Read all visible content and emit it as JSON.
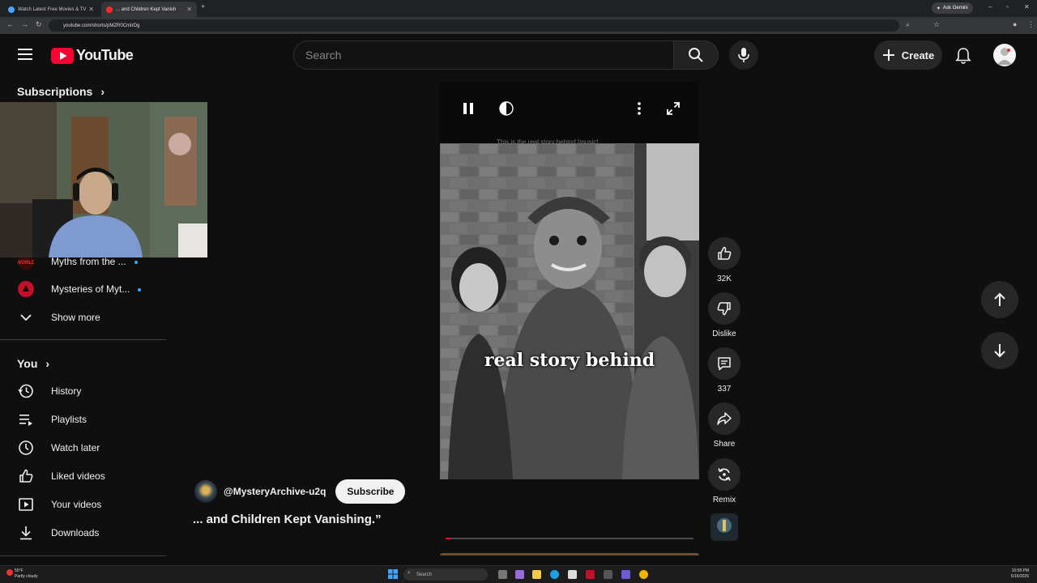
{
  "browser": {
    "tabs": [
      {
        "label": "Watch Latest Free Movies & TV",
        "favicon_color": "#4aa3ff"
      },
      {
        "label": "... and Children Kept Vanish",
        "favicon_color": "#ff2a2a"
      }
    ],
    "url": "youtube.com/shorts/pMZR0CmIrDg",
    "ask_gemini": "Ask Gemini"
  },
  "header": {
    "logo_text": "YouTube",
    "search_placeholder": "Search",
    "create_label": "Create"
  },
  "sidebar": {
    "subscriptions_title": "Subscriptions",
    "subscriptions": [
      {
        "label": "Myths from the ...",
        "icon": "channel-avatar",
        "new": true
      },
      {
        "label": "Mysteries of Myt...",
        "icon": "channel-avatar",
        "new": true
      }
    ],
    "show_more": "Show more",
    "you_title": "You",
    "you_items": [
      {
        "label": "History",
        "icon": "history-icon"
      },
      {
        "label": "Playlists",
        "icon": "playlists-icon"
      },
      {
        "label": "Watch later",
        "icon": "watch-later-icon"
      },
      {
        "label": "Liked videos",
        "icon": "like-icon"
      },
      {
        "label": "Your videos",
        "icon": "your-videos-icon"
      },
      {
        "label": "Downloads",
        "icon": "download-icon"
      }
    ]
  },
  "player": {
    "caption": "This is the real story behind [music]",
    "overlay_text": "real story behind",
    "progress": 0.02
  },
  "actions": {
    "like_count": "32K",
    "dislike_label": "Dislike",
    "comments_count": "337",
    "share_label": "Share",
    "remix_label": "Remix"
  },
  "channel": {
    "handle": "@MysteryArchive-u2q",
    "subscribe_label": "Subscribe"
  },
  "video": {
    "title": "... and Children Kept Vanishing.”"
  },
  "taskbar": {
    "weather_temp": "55°F",
    "weather_desc": "Partly cloudy",
    "search_label": "Search",
    "time": "10:58 PM",
    "date": "5/16/2026"
  },
  "colors": {
    "background": "#0f0f0f",
    "accent_red": "#ff0033",
    "link_blue": "#3ea6ff"
  }
}
